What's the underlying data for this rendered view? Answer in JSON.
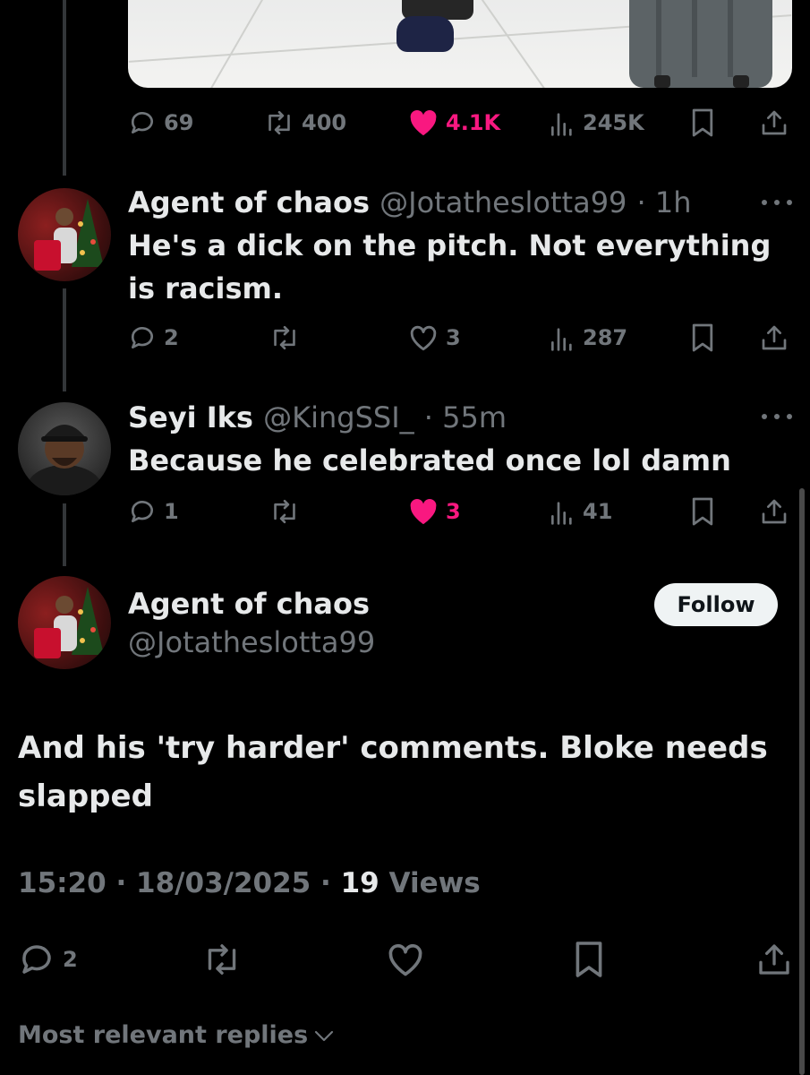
{
  "top_tweet": {
    "replies": "69",
    "reposts": "400",
    "likes": "4.1K",
    "views": "245K"
  },
  "replies": [
    {
      "name": "Agent of chaos",
      "handle": "@Jotatheslotta99",
      "time": "· 1h",
      "text": "He's a dick on the pitch. Not everything is racism.",
      "replies": "2",
      "reposts": "",
      "likes": "3",
      "views": "287"
    },
    {
      "name": "Seyi Iks",
      "handle": "@KingSSI_",
      "time": "· 55m",
      "text": "Because he celebrated once lol damn",
      "replies": "1",
      "reposts": "",
      "likes": "3",
      "views": "41"
    }
  ],
  "main_tweet": {
    "name": "Agent of chaos",
    "handle": "@Jotatheslotta99",
    "follow_label": "Follow",
    "text": "And his 'try harder' comments. Bloke needs slapped",
    "time": "15:20 · 18/03/2025 · ",
    "views_count": "19",
    "views_label": " Views",
    "replies": "2"
  },
  "sort_label": "Most relevant replies",
  "colors": {
    "background": "#000000",
    "text": "#e7e9ea",
    "muted": "#71767b",
    "like": "#f91880"
  },
  "icons": [
    "reply-icon",
    "repost-icon",
    "heart-icon",
    "views-icon",
    "bookmark-icon",
    "share-icon",
    "more-icon",
    "chevron-down-icon"
  ]
}
